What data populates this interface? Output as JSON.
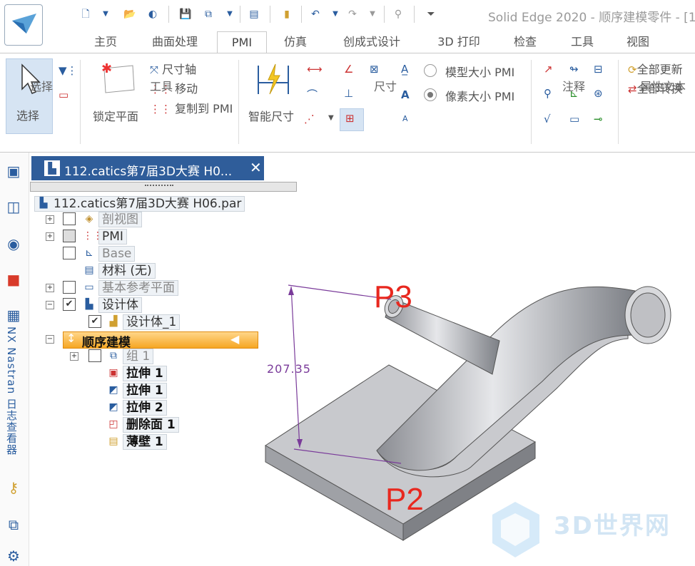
{
  "title_bar": {
    "title": "Solid Edge 2020 - 顺序建模零件 - [1"
  },
  "tabs": [
    "主页",
    "曲面处理",
    "PMI",
    "仿真",
    "创成式设计",
    "3D 打印",
    "检查",
    "工具",
    "视图"
  ],
  "active_tab": "PMI",
  "ribbon": {
    "select_label": "选择",
    "select_group": "选择",
    "lock_plane": "锁定平面",
    "tools": {
      "dim_axis": "尺寸轴",
      "move": "移动",
      "copy_to_pmi": "复制到 PMI"
    },
    "tools_group": "工具",
    "smart_dimension": "智能尺寸",
    "dimension_group": "尺寸",
    "model_size": "模型大小 PMI",
    "pixel_size": "像素大小 PMI",
    "annotation_group": "注释",
    "update_all": "全部更新",
    "convert_all": "全部转换",
    "property_text_group": "属性文本"
  },
  "left_strip": {
    "nastran": "NX Nastran 日志查看器"
  },
  "doc_tab": {
    "title": "112.catics第7届3D大赛 H0...",
    "close": "✕"
  },
  "tree": {
    "root": "112.catics第7届3D大赛 H06.par",
    "section_view": "剖视图",
    "pmi": "PMI",
    "base": "Base",
    "material": "材料 (无)",
    "ref_planes": "基本参考平面",
    "design_body": "设计体",
    "design_body_1": "设计体_1",
    "sequential": "顺序建模",
    "group1": "组 1",
    "extrude1a": "拉伸 1",
    "extrude1b": "拉伸 1",
    "extrude2": "拉伸 2",
    "delete_face": "删除面 1",
    "thin_wall": "薄壁 1"
  },
  "viewport": {
    "p3": "P3",
    "p2": "P2",
    "dimension": "207.35",
    "watermark": "3D世界网"
  },
  "colors": {
    "accent": "#2f5d9a",
    "sequential_highlight": "#f6a623",
    "dimension": "#7a3b9a",
    "label": "#e8281f"
  }
}
